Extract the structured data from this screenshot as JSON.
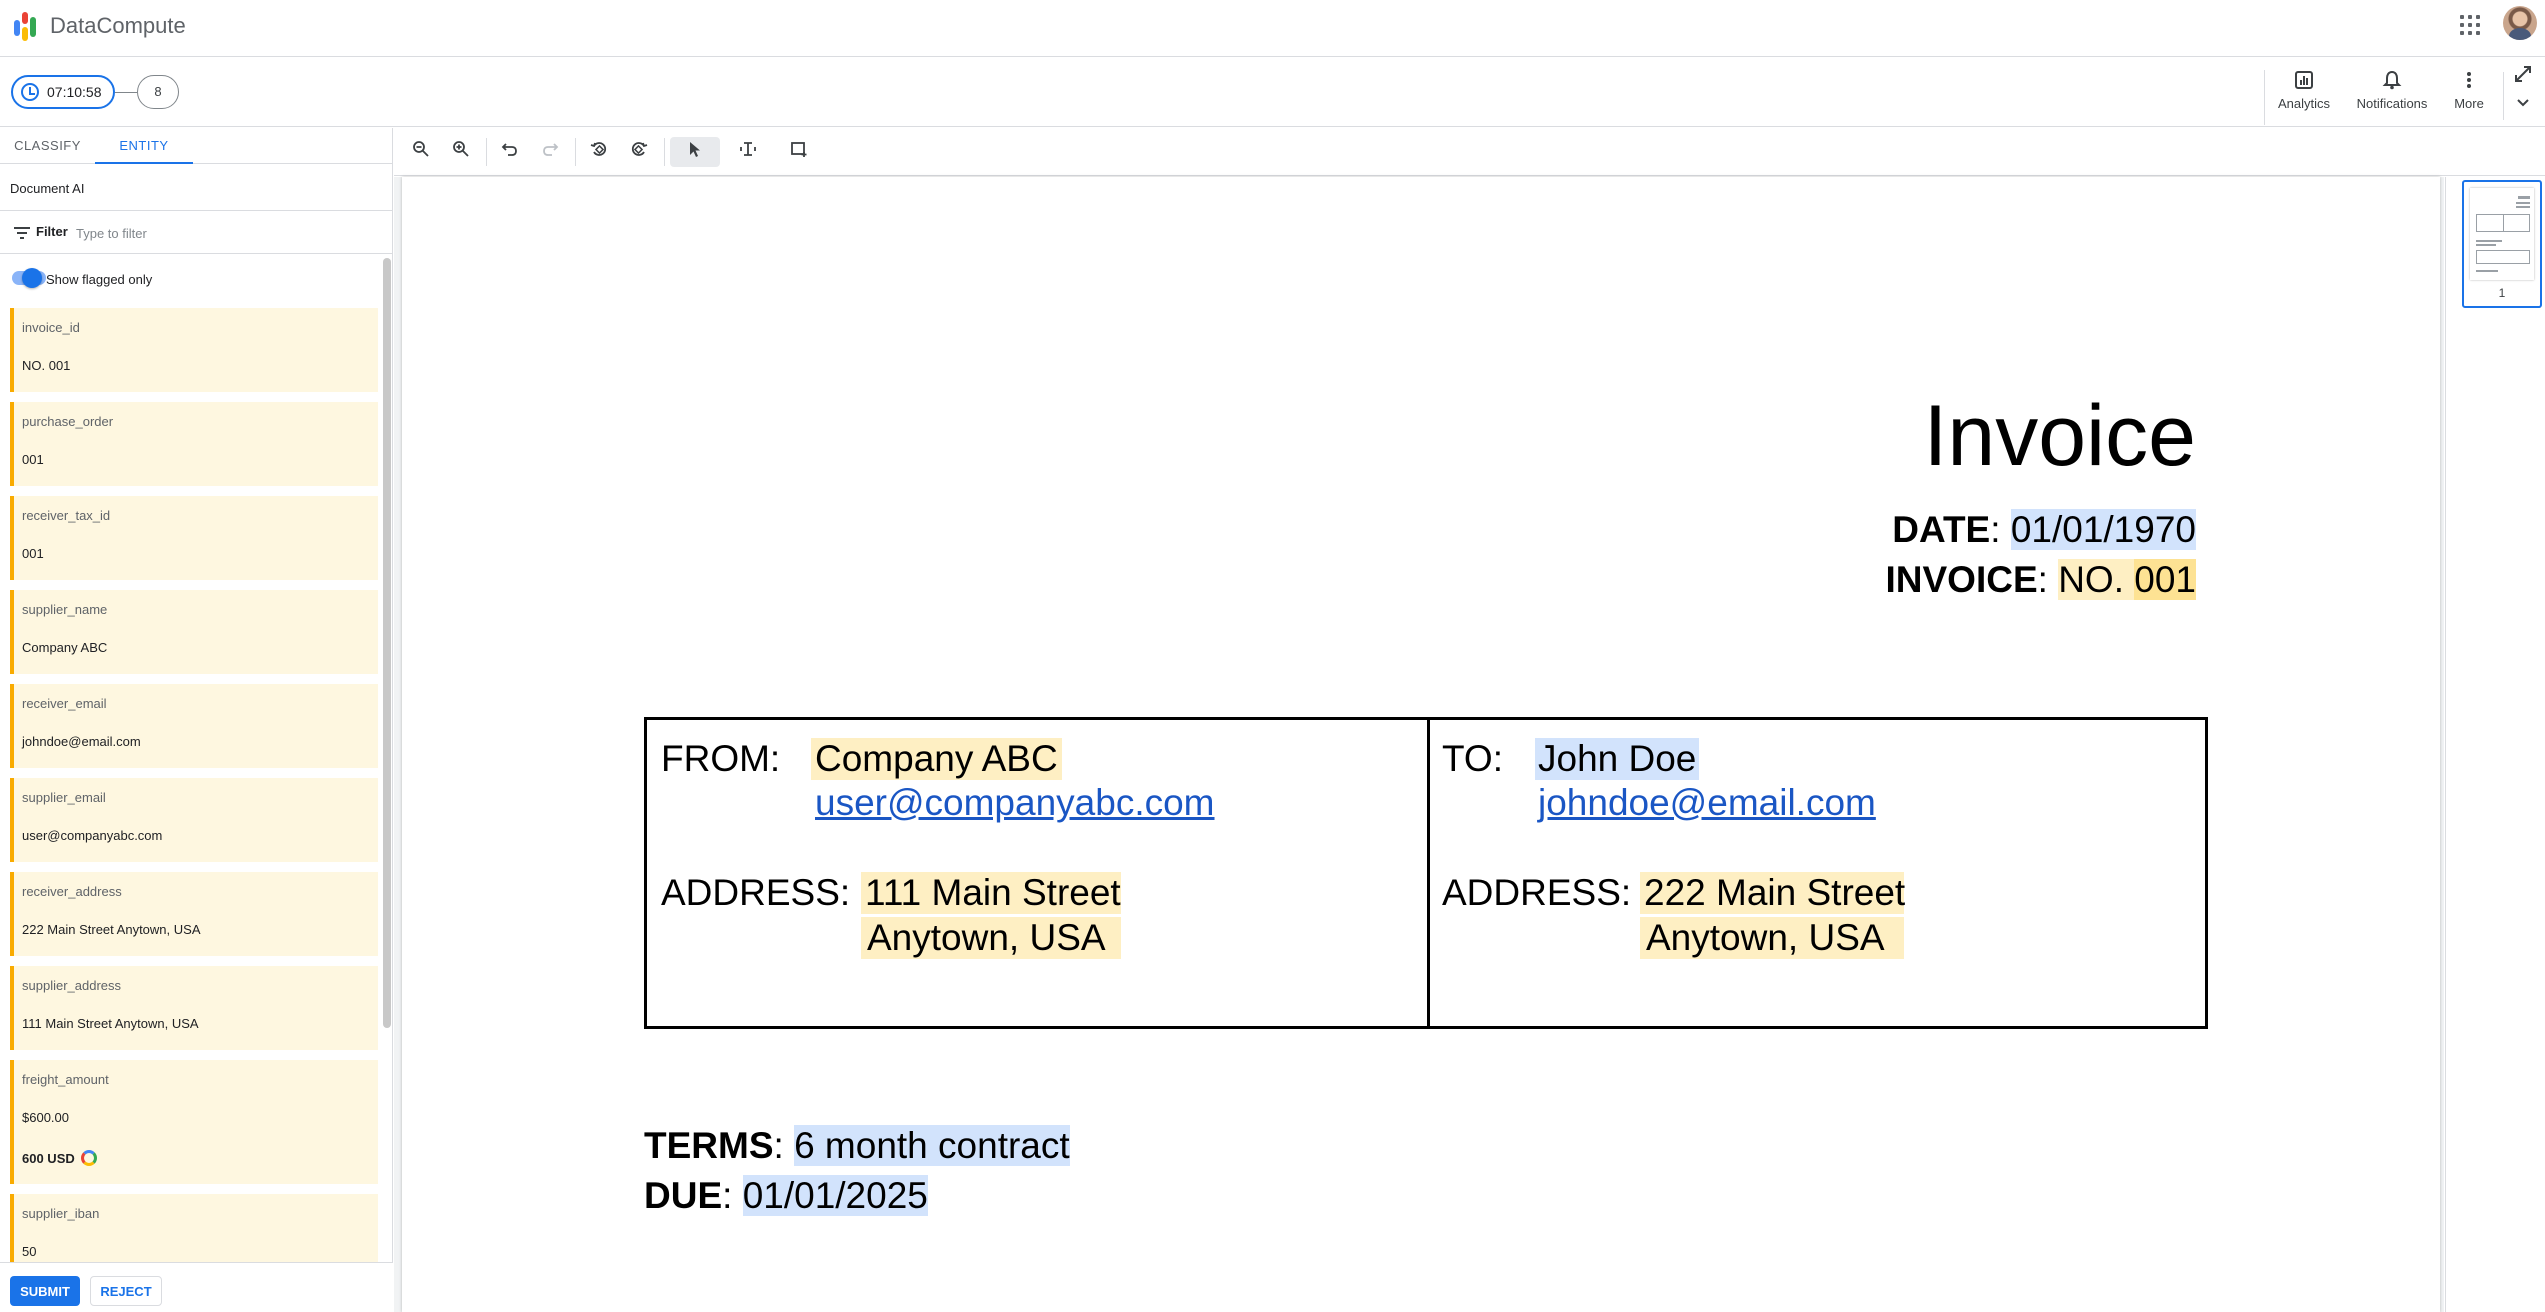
{
  "app": {
    "title": "DataCompute",
    "brand_colors": [
      "#4285f4",
      "#ea4335",
      "#fbbc04",
      "#34a853"
    ]
  },
  "session": {
    "timer": "07:10:58",
    "count": "8"
  },
  "actions": {
    "analytics": "Analytics",
    "notifications": "Notifications",
    "more": "More"
  },
  "tabs": {
    "classify": "CLASSIFY",
    "entity": "ENTITY",
    "active": "ENTITY"
  },
  "panel": {
    "title": "Document AI",
    "filter_label": "Filter",
    "filter_placeholder": "Type to filter",
    "toggle_label": "Show flagged only",
    "toggle_on": true
  },
  "entities": [
    {
      "name": "invoice_id",
      "value": "NO. 001"
    },
    {
      "name": "purchase_order",
      "value": "001"
    },
    {
      "name": "receiver_tax_id",
      "value": "001"
    },
    {
      "name": "supplier_name",
      "value": "Company ABC"
    },
    {
      "name": "receiver_email",
      "value": "johndoe@email.com"
    },
    {
      "name": "supplier_email",
      "value": "user@companyabc.com"
    },
    {
      "name": "receiver_address",
      "value": "222 Main Street Anytown, USA"
    },
    {
      "name": "supplier_address",
      "value": "111 Main Street Anytown, USA"
    },
    {
      "name": "freight_amount",
      "value": "$600.00",
      "normalized": "600 USD"
    },
    {
      "name": "supplier_iban",
      "value": "50"
    }
  ],
  "buttons": {
    "submit": "SUBMIT",
    "reject": "REJECT"
  },
  "document": {
    "title": "Invoice",
    "date_label": "DATE",
    "date_value": "01/01/1970",
    "invoice_label": "INVOICE",
    "invoice_no_prefix": "NO.",
    "invoice_no": "001",
    "from_label": "FROM:",
    "from_name": "Company ABC",
    "from_email": "user@companyabc.com",
    "from_address_label": "ADDRESS:",
    "from_address_line1": "111 Main Street",
    "from_address_line2": "Anytown, USA",
    "to_label": "TO:",
    "to_name": "John Doe",
    "to_email": "johndoe@email.com",
    "to_address_label": "ADDRESS:",
    "to_address_line1": "222 Main Street",
    "to_address_line2": "Anytown, USA",
    "terms_label": "TERMS",
    "terms_value": "6 month contract",
    "due_label": "DUE",
    "due_value": "01/01/2025"
  },
  "thumbnails": {
    "page_number": "1"
  },
  "highlight_colors": {
    "blue": "#d2e3fc",
    "amber": "#feefc3",
    "flag": "#f9ab00"
  }
}
